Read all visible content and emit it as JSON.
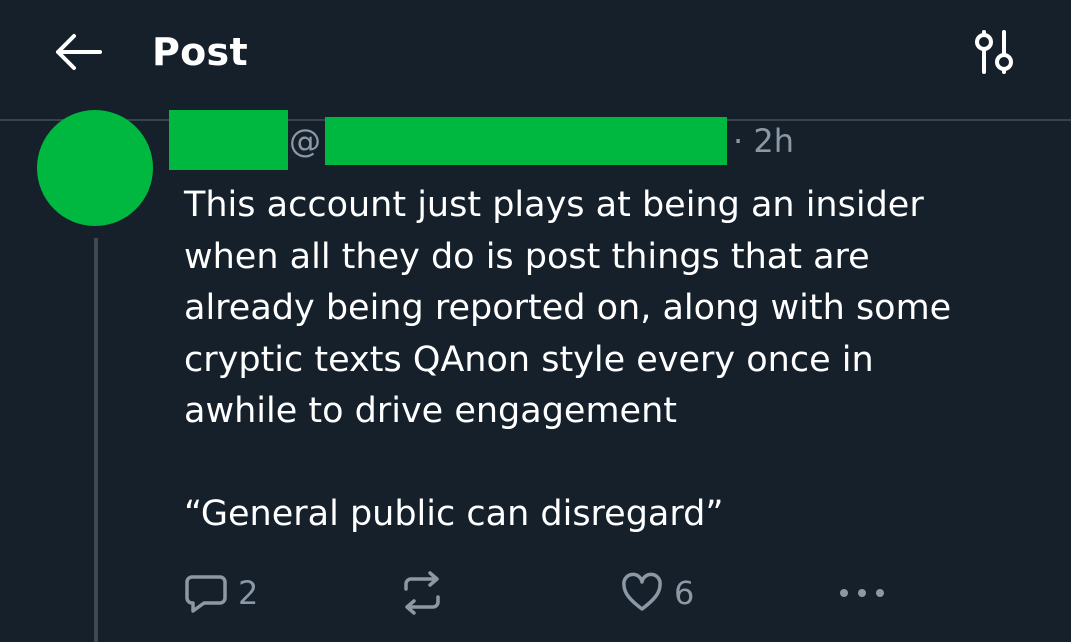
{
  "header": {
    "title": "Post",
    "back_icon": "arrow-left-icon",
    "settings_icon": "sliders-icon"
  },
  "tweet": {
    "avatar_color": "#00b83f",
    "redaction_color": "#00b83f",
    "handle_prefix": "@",
    "timestamp": "· 2h",
    "lines": [
      "This account just plays at being an insider",
      "when all they do is post things that are",
      "already being reported on, along with some",
      "cryptic texts QAnon style every once in",
      "awhile to drive engagement",
      "",
      "“General public can disregard”"
    ]
  },
  "actions": {
    "reply": {
      "icon": "reply-bubble-icon",
      "count": "2"
    },
    "retweet": {
      "icon": "retweet-icon",
      "count": ""
    },
    "like": {
      "icon": "heart-icon",
      "count": "6"
    },
    "more": {
      "icon": "more-dots-icon"
    }
  },
  "colors": {
    "background": "#15202b",
    "secondary_text": "#8b98a5",
    "divider": "#38444d"
  }
}
